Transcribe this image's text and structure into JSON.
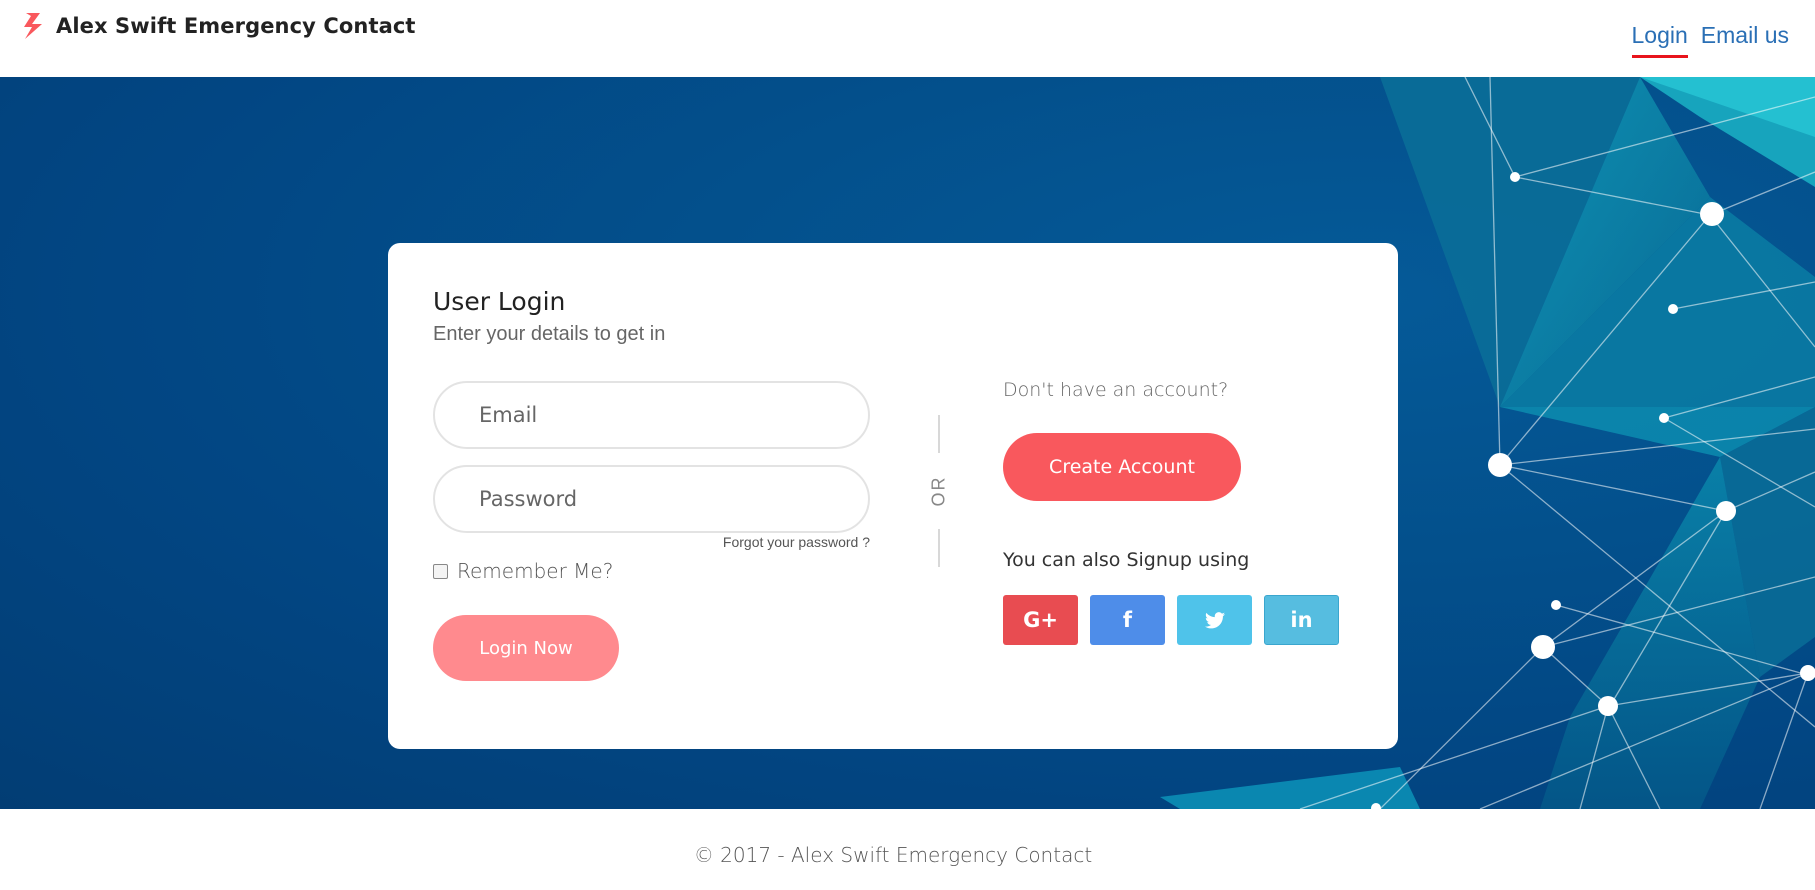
{
  "header": {
    "brand_name": "Alex Swift Emergency Contact",
    "brand_icon": "lightning-bolt-icon",
    "nav": [
      {
        "label": "Login",
        "active": true
      },
      {
        "label": "Email us",
        "active": false
      }
    ]
  },
  "login": {
    "title": "User Login",
    "subtitle": "Enter your details to get in",
    "email": {
      "placeholder": "Email",
      "value": ""
    },
    "password": {
      "placeholder": "Password",
      "value": ""
    },
    "forgot_label": "Forgot your password ?",
    "remember_label": "Remember Me?",
    "remember_checked": false,
    "submit_label": "Login Now",
    "divider_label": "OR"
  },
  "signup": {
    "prompt": "Don't have an account?",
    "create_label": "Create Account",
    "also_label": "You can also Signup using",
    "social": [
      {
        "name": "google-plus",
        "label": "G+",
        "icon": "google-plus-icon",
        "color": "#e84c51"
      },
      {
        "name": "facebook",
        "label": "f",
        "icon": "facebook-icon",
        "color": "#4e8de9"
      },
      {
        "name": "twitter",
        "label": "",
        "icon": "twitter-icon",
        "color": "#4fc3ea"
      },
      {
        "name": "linkedin",
        "label": "in",
        "icon": "linkedin-icon",
        "color": "#56bde0"
      }
    ]
  },
  "colors": {
    "accent": "#f9585d",
    "link": "#2a6fb5",
    "hero_bg": "#03508c"
  },
  "footer": {
    "text": "© 2017 - Alex Swift Emergency Contact"
  }
}
